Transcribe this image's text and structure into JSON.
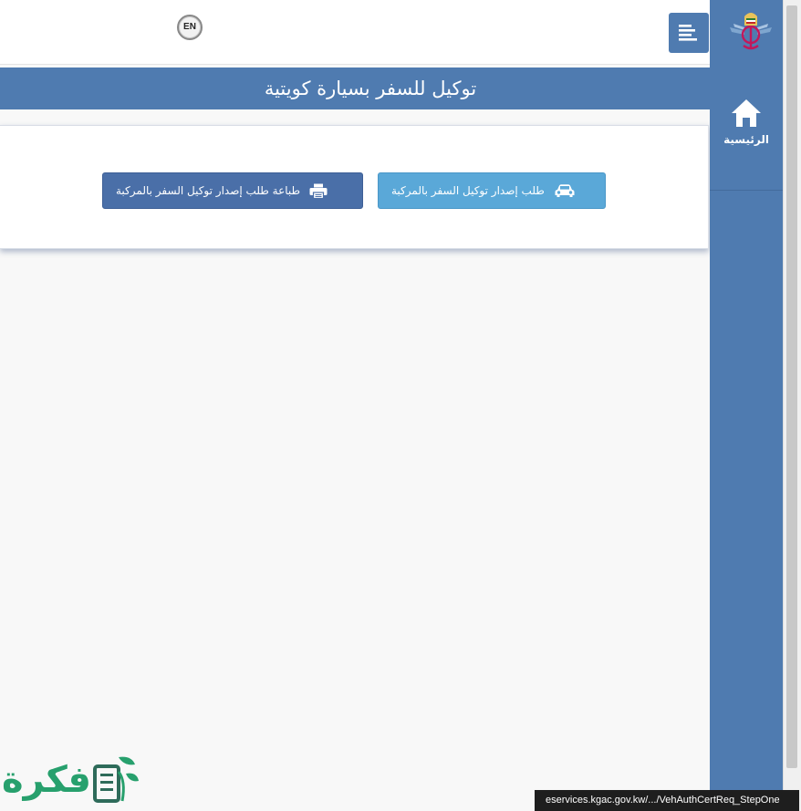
{
  "header": {
    "lang_button_label": "EN",
    "menu_icon": "menu-lines-icon"
  },
  "page": {
    "title": "توكيل للسفر بسيارة كويتية"
  },
  "actions": {
    "request_button_label": "طلب إصدار توكيل السفر بالمركبة",
    "request_button_icon": "car-icon",
    "print_button_label": "طباعة طلب إصدار توكيل السفر بالمركبة",
    "print_button_icon": "printer-icon"
  },
  "sidebar": {
    "logo_icon": "kgac-logo-icon",
    "home_label": "الرئيسية",
    "home_icon": "home-icon"
  },
  "statusbar": {
    "url": "eservices.kgac.gov.kw/.../VehAuthCertReq_StepOne"
  },
  "watermark": {
    "text": "فكرة"
  },
  "colors": {
    "primary": "#4f7bb0",
    "request_button": "#5aa8d8",
    "print_button": "#4a6fa8",
    "watermark": "#27a06d"
  }
}
